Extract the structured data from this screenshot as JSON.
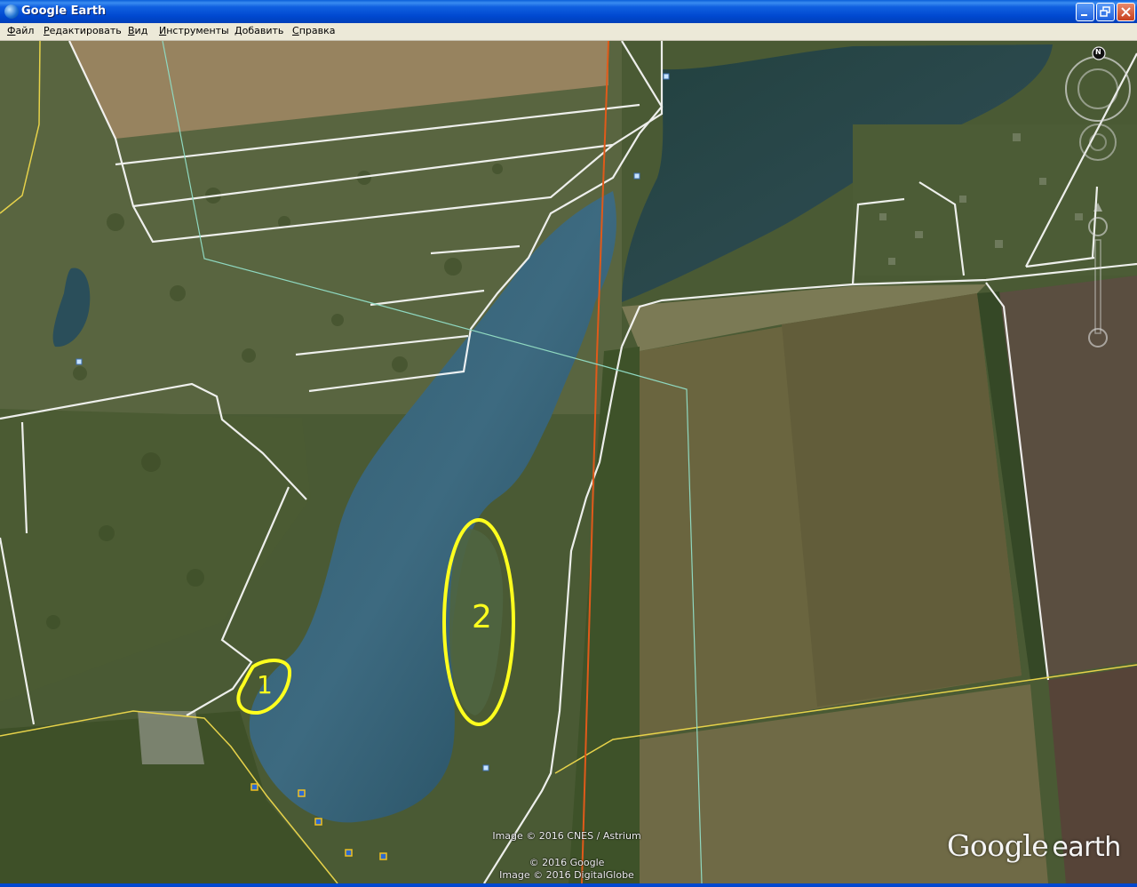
{
  "window": {
    "title": "Google Earth"
  },
  "menu": [
    "Файл",
    "Редактировать",
    "Вид",
    "Инструменты",
    "Добавить",
    "Справка"
  ],
  "markers": [
    {
      "label": "1"
    },
    {
      "label": "2"
    }
  ],
  "compass": {
    "north_label": "N"
  },
  "attribution": {
    "imagery": "Image © 2016 CNES / Astrium",
    "copyright": "© 2016 Google",
    "digitalglobe": "Image © 2016 DigitalGlobe"
  },
  "logo": {
    "google": "Google",
    "earth": "earth"
  },
  "colors": {
    "marker": "#ffff1e",
    "titlebar": "#0048d0",
    "boundary_line": "#ffffff",
    "road_line": "#e6d24a",
    "pipeline_line": "#e05a1a",
    "power_line": "#8fd8c0"
  }
}
